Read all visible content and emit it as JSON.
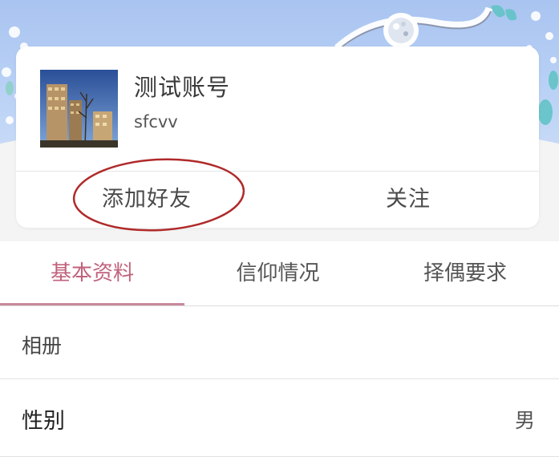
{
  "profile": {
    "display_name": "测试账号",
    "username": "sfcvv",
    "avatar_icon": "building-photo-avatar"
  },
  "actions": {
    "add_friend": "添加好友",
    "follow": "关注"
  },
  "tabs": [
    {
      "label": "基本资料",
      "active": true
    },
    {
      "label": "信仰情况",
      "active": false
    },
    {
      "label": "择偶要求",
      "active": false
    }
  ],
  "rows": {
    "album": {
      "label": "相册"
    },
    "gender": {
      "label": "性别",
      "value": "男"
    }
  },
  "colors": {
    "active_tab": "#c0627c",
    "annotation_circle": "#b02a2a",
    "banner": "#b9d1f6"
  }
}
